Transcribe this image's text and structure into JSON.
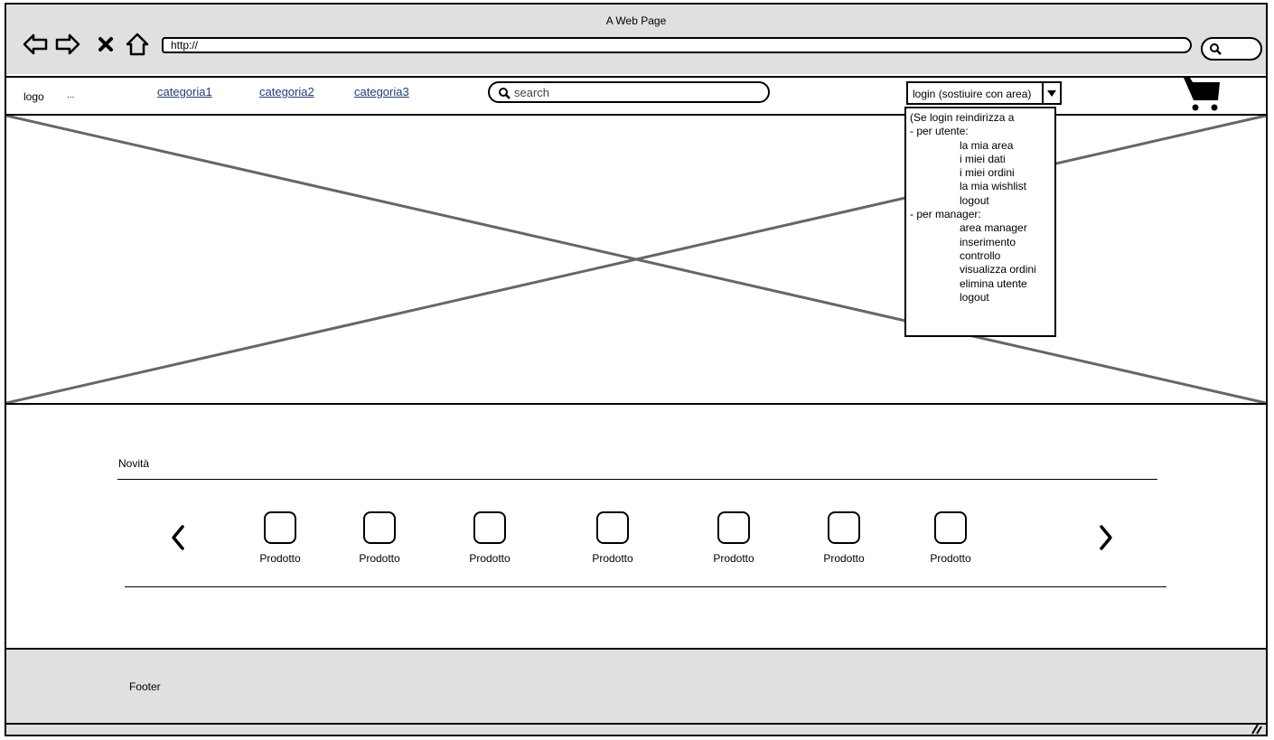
{
  "window": {
    "title": "A Web Page"
  },
  "browser": {
    "url": "http://"
  },
  "navbar": {
    "logo": "logo",
    "logo_suffix": "...",
    "categories": [
      "categoria1",
      "categoria2",
      "categoria3"
    ],
    "search_placeholder": "search",
    "login_value": "login (sostiuire con area)"
  },
  "login_dropdown": {
    "heading": "(Se login reindirizza a",
    "user_group": "- per utente:",
    "user_items": [
      "la mia area",
      "i miei dati",
      "i miei ordini",
      "la mia wishlist",
      "logout"
    ],
    "manager_group": "- per manager:",
    "manager_items": [
      "area manager",
      "inserimento",
      "controllo",
      "visualizza ordini",
      "elimina utente",
      "logout"
    ]
  },
  "section": {
    "title": "Novità",
    "products": [
      "Prodotto",
      "Prodotto",
      "Prodotto",
      "Prodotto",
      "Prodotto",
      "Prodotto",
      "Prodotto"
    ]
  },
  "footer": {
    "text": "Footer"
  },
  "icons": {
    "back": "back-arrow-icon",
    "forward": "forward-arrow-icon",
    "stop": "close-icon",
    "home": "home-icon",
    "search": "search-icon",
    "cart": "shopping-cart-icon",
    "prev": "chevron-left-icon",
    "next": "chevron-right-icon"
  }
}
